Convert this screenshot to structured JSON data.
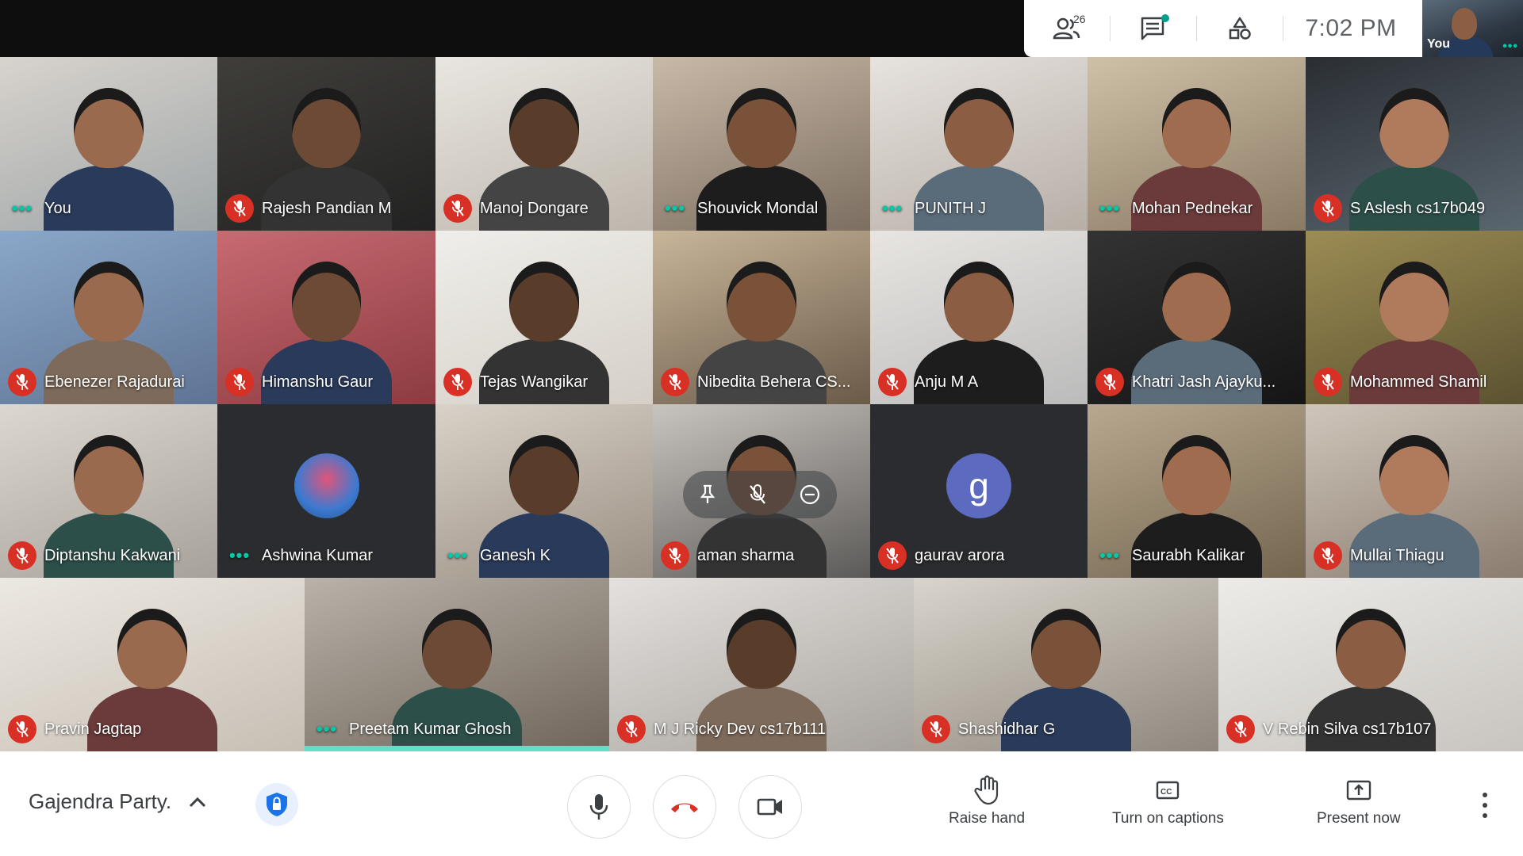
{
  "topbar": {
    "participants_count": "26",
    "time": "7:02 PM",
    "self_view_label": "You",
    "icons": [
      "people-icon",
      "chat-icon",
      "activities-icon"
    ]
  },
  "tiles": [
    {
      "name": "You",
      "state": "active"
    },
    {
      "name": "Rajesh Pandian M",
      "state": "muted"
    },
    {
      "name": "Manoj Dongare",
      "state": "muted"
    },
    {
      "name": "Shouvick Mondal",
      "state": "active"
    },
    {
      "name": "PUNITH J",
      "state": "active"
    },
    {
      "name": "Mohan Pednekar",
      "state": "active"
    },
    {
      "name": "S Aslesh cs17b049",
      "state": "muted"
    },
    {
      "name": "Ebenezer Rajadurai",
      "state": "muted"
    },
    {
      "name": "Himanshu Gaur",
      "state": "muted"
    },
    {
      "name": "Tejas Wangikar",
      "state": "muted"
    },
    {
      "name": "Nibedita Behera CS...",
      "state": "muted"
    },
    {
      "name": "Anju M A",
      "state": "muted"
    },
    {
      "name": "Khatri Jash Ajayku...",
      "state": "muted"
    },
    {
      "name": "Mohammed Shamil",
      "state": "muted"
    },
    {
      "name": "Diptanshu Kakwani",
      "state": "muted"
    },
    {
      "name": "Ashwina Kumar",
      "state": "active"
    },
    {
      "name": "Ganesh K",
      "state": "active"
    },
    {
      "name": "aman sharma",
      "state": "muted"
    },
    {
      "name": "gaurav arora",
      "state": "muted",
      "avatar_letter": "g"
    },
    {
      "name": "Saurabh Kalikar",
      "state": "active"
    },
    {
      "name": "Mullai Thiagu",
      "state": "muted"
    },
    {
      "name": "Pravin Jagtap",
      "state": "muted"
    },
    {
      "name": "Preetam Kumar Ghosh",
      "state": "active"
    },
    {
      "name": "M J Ricky Dev cs17b111",
      "state": "muted"
    },
    {
      "name": "Shashidhar G",
      "state": "muted"
    },
    {
      "name": "V Rebin Silva cs17b107",
      "state": "muted"
    }
  ],
  "bottombar": {
    "meeting_name": "Gajendra Party.",
    "raise_hand": "Raise hand",
    "captions": "Turn on captions",
    "present": "Present now"
  },
  "colors": {
    "mute_red": "#d93025",
    "accent_teal": "#00c9a7",
    "hangup_red": "#d93025"
  }
}
